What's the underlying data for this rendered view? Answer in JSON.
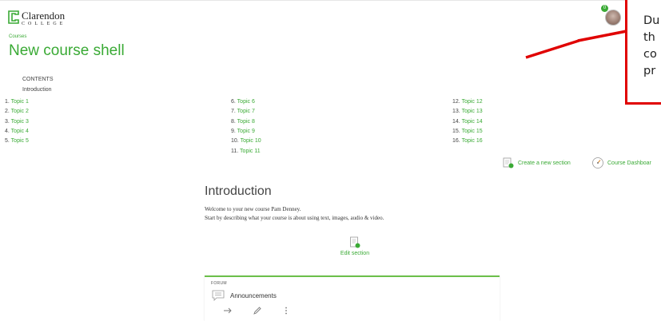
{
  "header": {
    "logo_name": "Clarendon",
    "logo_sub": "COLLEGE",
    "notification_count": "0"
  },
  "breadcrumb": "Courses",
  "page_title": "New course shell",
  "contents": {
    "heading": "CONTENTS",
    "intro": "Introduction",
    "topics": [
      {
        "num": "1.",
        "label": "Topic 1"
      },
      {
        "num": "2.",
        "label": "Topic 2"
      },
      {
        "num": "3.",
        "label": "Topic 3"
      },
      {
        "num": "4.",
        "label": "Topic 4"
      },
      {
        "num": "5.",
        "label": "Topic 5"
      },
      {
        "num": "6.",
        "label": "Topic 6"
      },
      {
        "num": "7.",
        "label": "Topic 7"
      },
      {
        "num": "8.",
        "label": "Topic 8"
      },
      {
        "num": "9.",
        "label": "Topic 9"
      },
      {
        "num": "10.",
        "label": "Topic 10"
      },
      {
        "num": "11.",
        "label": "Topic 11"
      },
      {
        "num": "12.",
        "label": "Topic 12"
      },
      {
        "num": "13.",
        "label": "Topic 13"
      },
      {
        "num": "14.",
        "label": "Topic 14"
      },
      {
        "num": "15.",
        "label": "Topic 15"
      },
      {
        "num": "16.",
        "label": "Topic 16"
      }
    ]
  },
  "actions": {
    "create_section": "Create a new section",
    "course_dashboard": "Course Dashboar"
  },
  "introduction": {
    "title": "Introduction",
    "line1": "Welcome to your new course Pam Denney.",
    "line2": "Start by describing what your course is about using text, images, audio & video.",
    "edit_section": "Edit section"
  },
  "forum": {
    "type_label": "FORUM",
    "title": "Announcements"
  },
  "annotation": {
    "text": "Du\nth\nco\npr"
  },
  "colors": {
    "accent": "#3aaa35",
    "annotation": "#e00000"
  }
}
